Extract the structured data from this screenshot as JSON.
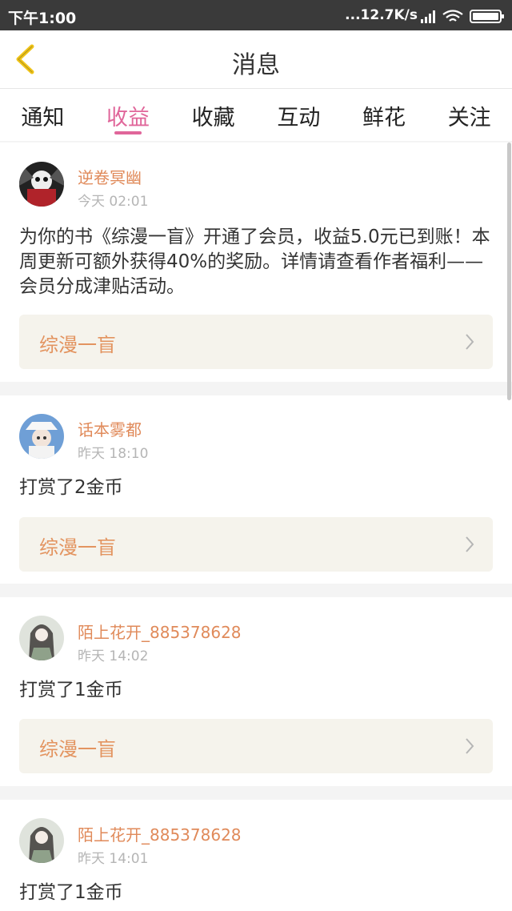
{
  "status_bar": {
    "time": "下午1:00",
    "network_speed": "...12.7K/s"
  },
  "header": {
    "title": "消息"
  },
  "tabs": [
    {
      "label": "通知",
      "active": false
    },
    {
      "label": "收益",
      "active": true
    },
    {
      "label": "收藏",
      "active": false
    },
    {
      "label": "互动",
      "active": false
    },
    {
      "label": "鲜花",
      "active": false
    },
    {
      "label": "关注",
      "active": false
    }
  ],
  "messages": [
    {
      "user": "逆卷冥幽",
      "time": "今天 02:01",
      "text": "为你的书《综漫一盲》开通了会员，收益5.0元已到账！本周更新可额外获得40%的奖励。详情请查看作者福利——会员分成津贴活动。",
      "book": "综漫一盲"
    },
    {
      "user": "话本雾都",
      "time": "昨天 18:10",
      "text": "打赏了2金币",
      "book": "综漫一盲"
    },
    {
      "user": "陌上花开_885378628",
      "time": "昨天 14:02",
      "text": "打赏了1金币",
      "book": "综漫一盲"
    },
    {
      "user": "陌上花开_885378628",
      "time": "昨天 14:01",
      "text": "打赏了1金币"
    }
  ],
  "colors": {
    "accent": "#e0669a",
    "username": "#e08a5a",
    "book_link": "#e39460",
    "book_bg": "#f5f3ec",
    "back_arrow": "#f0c419"
  }
}
